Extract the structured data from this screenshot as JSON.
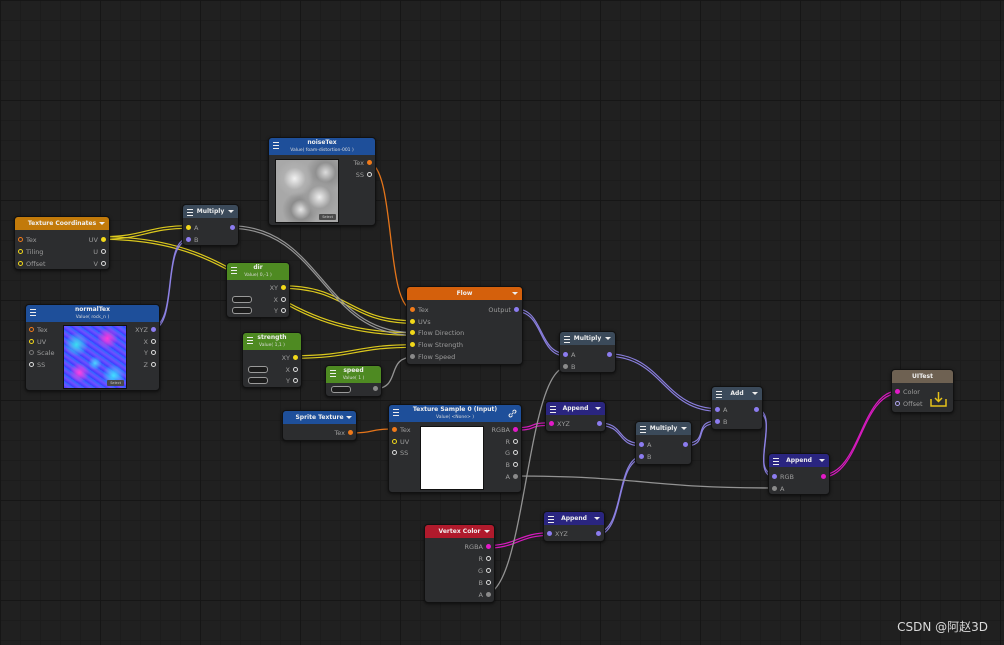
{
  "nodes": {
    "texcoords": {
      "title": "Texture Coordinates",
      "inputs": [
        "Tex",
        "Tiling",
        "Offset"
      ],
      "outputs": [
        "UV",
        "U",
        "V"
      ]
    },
    "multiply1": {
      "title": "Multiply",
      "inputs": [
        "A",
        "B"
      ]
    },
    "noiseTex": {
      "title": "noiseTex",
      "subtitle": "Value( foam-distortion-001 )",
      "outputs": [
        "Tex",
        "SS"
      ],
      "select": "Select"
    },
    "normalTex": {
      "title": "normalTex",
      "subtitle": "Value( rock_n )",
      "inputs": [
        "Tex",
        "UV",
        "Scale",
        "SS"
      ],
      "outputs": [
        "XYZ",
        "X",
        "Y",
        "Z"
      ],
      "select": "Select"
    },
    "dir": {
      "title": "dir",
      "subtitle": "Value( 0,-1 )",
      "outputs": [
        "XY",
        "X",
        "Y"
      ]
    },
    "strength": {
      "title": "strength",
      "subtitle": "Value( 1,1 )",
      "outputs": [
        "XY",
        "X",
        "Y"
      ]
    },
    "speed": {
      "title": "speed",
      "subtitle": "Value( 1 )"
    },
    "flow": {
      "title": "Flow",
      "inputs": [
        "Tex",
        "UVs",
        "Flow Direction",
        "Flow Strength",
        "Flow Speed"
      ],
      "outputs": [
        "Output"
      ]
    },
    "multiply2": {
      "title": "Multiply",
      "inputs": [
        "A",
        "B"
      ]
    },
    "spriteTexture": {
      "title": "Sprite Texture",
      "outputs": [
        "Tex"
      ]
    },
    "textureSample": {
      "title": "Texture Sample 0 (Input)",
      "subtitle": "Value( <None> )",
      "inputs": [
        "Tex",
        "UV",
        "SS"
      ],
      "outputs": [
        "RGBA",
        "R",
        "G",
        "B",
        "A"
      ]
    },
    "append1": {
      "title": "Append",
      "inputs": [
        "XYZ"
      ]
    },
    "multiply3": {
      "title": "Multiply",
      "inputs": [
        "A",
        "B"
      ]
    },
    "add": {
      "title": "Add",
      "inputs": [
        "A",
        "B"
      ]
    },
    "append2": {
      "title": "Append",
      "inputs": [
        "RGB",
        "A"
      ]
    },
    "uitest": {
      "title": "UITest",
      "inputs": [
        "Color",
        "Offset"
      ]
    },
    "vertexColor": {
      "title": "Vertex Color",
      "outputs": [
        "RGBA",
        "R",
        "G",
        "B",
        "A"
      ]
    },
    "append3": {
      "title": "Append",
      "inputs": [
        "XYZ"
      ]
    }
  },
  "colors": {
    "header_orange": "#c27a0a",
    "header_blue": "#1e4f9a",
    "header_green": "#4e8a22",
    "header_dark": "#3b4a5a",
    "header_flow": "#d4600c",
    "header_red": "#b01a2c",
    "header_brown": "#6e6152",
    "header_purple": "#2a2580",
    "wire_yellow": "#e6d21e",
    "wire_purple": "#8f84e8",
    "wire_orange": "#f07a1a",
    "wire_magenta": "#e21ac8",
    "wire_gray": "#9a9a9a"
  },
  "icons": [
    "menu-icon",
    "dropdown-icon",
    "link-icon",
    "output-icon"
  ],
  "watermark": "CSDN @阿赵3D"
}
